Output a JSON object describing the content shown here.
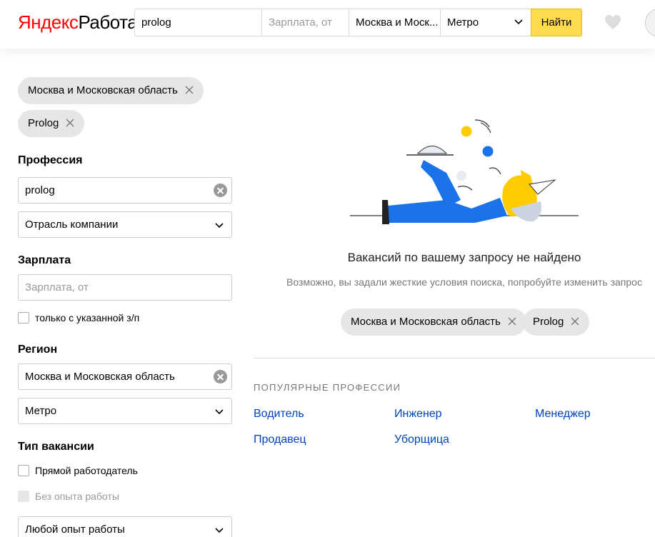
{
  "header": {
    "logo_brand": "Яндекс",
    "logo_service": "Работа",
    "search_value": "prolog",
    "salary_placeholder": "Зарплата, от",
    "region_value": "Москва и Моск...",
    "metro_value": "Метро",
    "find_label": "Найти"
  },
  "top_chips": [
    {
      "label": "Москва и Московская область"
    },
    {
      "label": "Prolog"
    }
  ],
  "sidebar": {
    "profession_title": "Профессия",
    "profession_value": "prolog",
    "industry_value": "Отрасль компании",
    "salary_title": "Зарплата",
    "salary_placeholder": "Зарплата, от",
    "salary_only_label": "только с указанной з/п",
    "region_title": "Регион",
    "region_value": "Москва и Московская область",
    "metro_value": "Метро",
    "vacancy_type_title": "Тип вакансии",
    "direct_employer_label": "Прямой работодатель",
    "no_experience_label": "Без опыта работы",
    "experience_value": "Любой опыт работы"
  },
  "main": {
    "empty_title": "Вакансий по вашему запросу не найдено",
    "empty_subtitle": "Возможно, вы задали жесткие условия поиска, попробуйте изменить запрос",
    "chips": [
      {
        "label": "Москва и Московская область"
      },
      {
        "label": "Prolog"
      }
    ],
    "popular_title": "ПОПУЛЯРНЫЕ ПРОФЕССИИ",
    "popular": [
      "Водитель",
      "Инженер",
      "Менеджер",
      "Продавец",
      "Уборщица"
    ]
  },
  "colors": {
    "accent_yellow": "#ffdb4d",
    "logo_red": "#ff0000",
    "link_blue": "#0044bb",
    "chip_gray": "#e6e6e6"
  }
}
